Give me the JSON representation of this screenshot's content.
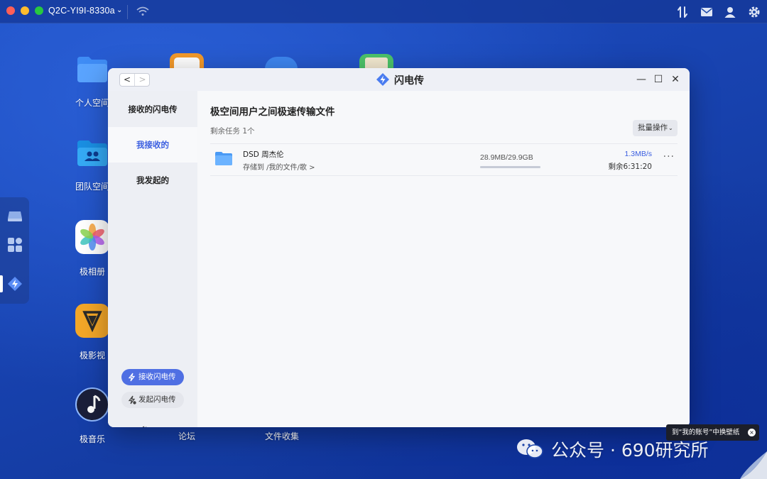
{
  "topbar": {
    "device_name": "Q2C-YI9I-8330a",
    "device_chevron": "⌄",
    "icons": [
      "wifi-icon",
      "transfer-icon",
      "mail-icon",
      "user-icon",
      "gear-icon"
    ]
  },
  "desktop": {
    "icons": [
      {
        "label": "个人空间",
        "icon": "personal-folder-icon"
      },
      {
        "label": "团队空间",
        "icon": "team-folder-icon"
      },
      {
        "label": "极相册",
        "icon": "photos-icon"
      },
      {
        "label": "极影视",
        "icon": "video-icon"
      },
      {
        "label": "极音乐",
        "icon": "music-icon"
      },
      {
        "label": "论坛",
        "icon": "forum-icon"
      },
      {
        "label": "文件收集",
        "icon": "file-collect-icon"
      }
    ]
  },
  "window": {
    "title": "闪电传",
    "nav_back": "<",
    "nav_forward": ">",
    "minimize": "—",
    "maximize": "☐",
    "close": "✕",
    "sidebar": {
      "header": "接收的闪电传",
      "items": [
        {
          "label": "我接收的",
          "active": true
        },
        {
          "label": "我发起的",
          "active": false
        }
      ],
      "receive_button": "接收闪电传",
      "send_button": "发起闪电传",
      "settings_label": "设置"
    },
    "main": {
      "title": "极空间用户之间极速传输文件",
      "remaining": "剩余任务 1个",
      "batch_button": "批量操作",
      "batch_chevron": "⌄",
      "transfers": [
        {
          "name": "DSD 周杰伦",
          "path": "存储到 /我的文件/歌 >",
          "size": "28.9MB/29.9GB",
          "progress": 0.001,
          "speed": "1.3MB/s",
          "eta": "剩余6:31:20",
          "more": "···"
        }
      ]
    }
  },
  "tooltip": {
    "text": "到“我的账号”中换壁纸",
    "close": "×"
  },
  "watermark": {
    "text": "公众号 · 690研究所"
  },
  "colors": {
    "accent": "#3a5ee0",
    "desktop_bg": "#1a47b8",
    "pill_active": "#4f6fe3"
  }
}
